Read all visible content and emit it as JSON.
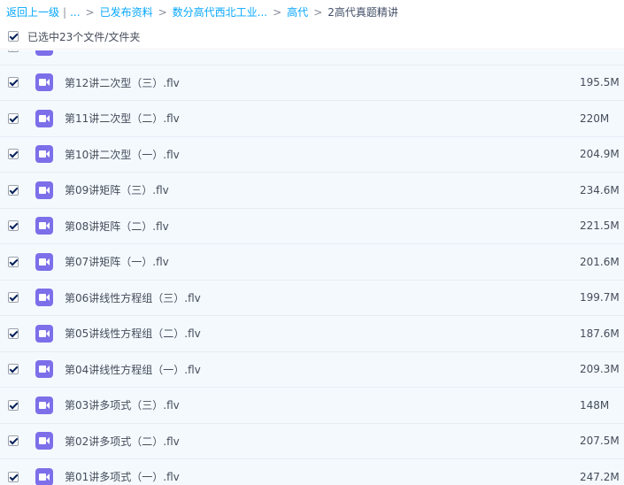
{
  "breadcrumb": {
    "items": [
      "返回上一级",
      "...",
      "已发布资料",
      "数分高代西北工业...",
      "高代",
      "2高代真题精讲"
    ],
    "separator_pipe": "|",
    "separator": ">"
  },
  "selection": {
    "text": "已选中23个文件/文件夹",
    "checked": true
  },
  "files": [
    {
      "name": "",
      "size": "",
      "checked": true
    },
    {
      "name": "第12讲二次型（三）.flv",
      "size": "195.5M",
      "checked": true
    },
    {
      "name": "第11讲二次型（二）.flv",
      "size": "220M",
      "checked": true
    },
    {
      "name": "第10讲二次型（一）.flv",
      "size": "204.9M",
      "checked": true
    },
    {
      "name": "第09讲矩阵（三）.flv",
      "size": "234.6M",
      "checked": true
    },
    {
      "name": "第08讲矩阵（二）.flv",
      "size": "221.5M",
      "checked": true
    },
    {
      "name": "第07讲矩阵（一）.flv",
      "size": "201.6M",
      "checked": true
    },
    {
      "name": "第06讲线性方程组（三）.flv",
      "size": "199.7M",
      "checked": true
    },
    {
      "name": "第05讲线性方程组（二）.flv",
      "size": "187.6M",
      "checked": true
    },
    {
      "name": "第04讲线性方程组（一）.flv",
      "size": "209.3M",
      "checked": true
    },
    {
      "name": "第03讲多项式（三）.flv",
      "size": "148M",
      "checked": true
    },
    {
      "name": "第02讲多项式（二）.flv",
      "size": "207.5M",
      "checked": true
    },
    {
      "name": "第01讲多项式（一）.flv",
      "size": "247.2M",
      "checked": true
    }
  ],
  "colors": {
    "link": "#06a7ff",
    "video_icon": "#7c6fe9",
    "row_bg": "#f4f9fe"
  },
  "icons": {
    "file_type": "video-file-icon",
    "checkbox": "checkbox-checked-icon"
  }
}
